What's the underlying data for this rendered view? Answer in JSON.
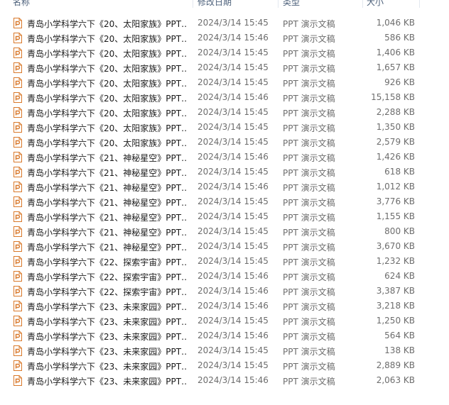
{
  "columns": {
    "name": "名称",
    "date": "修改日期",
    "type": "类型",
    "size": "大小"
  },
  "colors": {
    "icon": "#d9792b",
    "header_text": "#4c607a"
  },
  "files": [
    {
      "icon": "ppt-icon",
      "name": "青岛小学科学六下《20、太阳家族》PPT…",
      "date": "2024/3/14 15:45",
      "type": "PPT 演示文稿",
      "size": "1,046 KB"
    },
    {
      "icon": "ppt-icon",
      "name": "青岛小学科学六下《20、太阳家族》PPT…",
      "date": "2024/3/14 15:46",
      "type": "PPT 演示文稿",
      "size": "586 KB"
    },
    {
      "icon": "ppt-icon",
      "name": "青岛小学科学六下《20、太阳家族》PPT…",
      "date": "2024/3/14 15:45",
      "type": "PPT 演示文稿",
      "size": "1,406 KB"
    },
    {
      "icon": "ppt-icon",
      "name": "青岛小学科学六下《20、太阳家族》PPT…",
      "date": "2024/3/14 15:45",
      "type": "PPT 演示文稿",
      "size": "1,657 KB"
    },
    {
      "icon": "ppt-icon",
      "name": "青岛小学科学六下《20、太阳家族》PPT…",
      "date": "2024/3/14 15:45",
      "type": "PPT 演示文稿",
      "size": "926 KB"
    },
    {
      "icon": "ppt-icon",
      "name": "青岛小学科学六下《20、太阳家族》PPT…",
      "date": "2024/3/14 15:46",
      "type": "PPT 演示文稿",
      "size": "15,158 KB"
    },
    {
      "icon": "ppt-icon",
      "name": "青岛小学科学六下《20、太阳家族》PPT…",
      "date": "2024/3/14 15:45",
      "type": "PPT 演示文稿",
      "size": "2,288 KB"
    },
    {
      "icon": "ppt-icon",
      "name": "青岛小学科学六下《20、太阳家族》PPT…",
      "date": "2024/3/14 15:45",
      "type": "PPT 演示文稿",
      "size": "1,350 KB"
    },
    {
      "icon": "ppt-icon",
      "name": "青岛小学科学六下《20、太阳家族》PPT…",
      "date": "2024/3/14 15:45",
      "type": "PPT 演示文稿",
      "size": "2,579 KB"
    },
    {
      "icon": "ppt-icon",
      "name": "青岛小学科学六下《21、神秘星空》PPT…",
      "date": "2024/3/14 15:46",
      "type": "PPT 演示文稿",
      "size": "1,426 KB"
    },
    {
      "icon": "ppt-icon",
      "name": "青岛小学科学六下《21、神秘星空》PPT…",
      "date": "2024/3/14 15:45",
      "type": "PPT 演示文稿",
      "size": "618 KB"
    },
    {
      "icon": "ppt-icon",
      "name": "青岛小学科学六下《21、神秘星空》PPT…",
      "date": "2024/3/14 15:46",
      "type": "PPT 演示文稿",
      "size": "1,012 KB"
    },
    {
      "icon": "ppt-icon",
      "name": "青岛小学科学六下《21、神秘星空》PPT…",
      "date": "2024/3/14 15:45",
      "type": "PPT 演示文稿",
      "size": "3,776 KB"
    },
    {
      "icon": "ppt-icon",
      "name": "青岛小学科学六下《21、神秘星空》PPT…",
      "date": "2024/3/14 15:45",
      "type": "PPT 演示文稿",
      "size": "1,155 KB"
    },
    {
      "icon": "ppt-icon",
      "name": "青岛小学科学六下《21、神秘星空》PPT…",
      "date": "2024/3/14 15:45",
      "type": "PPT 演示文稿",
      "size": "800 KB"
    },
    {
      "icon": "ppt-icon",
      "name": "青岛小学科学六下《21、神秘星空》PPT…",
      "date": "2024/3/14 15:45",
      "type": "PPT 演示文稿",
      "size": "3,670 KB"
    },
    {
      "icon": "ppt-icon",
      "name": "青岛小学科学六下《22、探索宇宙》PPT…",
      "date": "2024/3/14 15:45",
      "type": "PPT 演示文稿",
      "size": "1,232 KB"
    },
    {
      "icon": "ppt-icon",
      "name": "青岛小学科学六下《22、探索宇宙》PPT…",
      "date": "2024/3/14 15:46",
      "type": "PPT 演示文稿",
      "size": "624 KB"
    },
    {
      "icon": "ppt-icon",
      "name": "青岛小学科学六下《22、探索宇宙》PPT…",
      "date": "2024/3/14 15:46",
      "type": "PPT 演示文稿",
      "size": "3,387 KB"
    },
    {
      "icon": "ppt-icon",
      "name": "青岛小学科学六下《23、未来家园》PPT…",
      "date": "2024/3/14 15:46",
      "type": "PPT 演示文稿",
      "size": "3,218 KB"
    },
    {
      "icon": "ppt-icon",
      "name": "青岛小学科学六下《23、未来家园》PPT…",
      "date": "2024/3/14 15:45",
      "type": "PPT 演示文稿",
      "size": "1,250 KB"
    },
    {
      "icon": "ppt-icon",
      "name": "青岛小学科学六下《23、未来家园》PPT…",
      "date": "2024/3/14 15:46",
      "type": "PPT 演示文稿",
      "size": "564 KB"
    },
    {
      "icon": "ppt-icon",
      "name": "青岛小学科学六下《23、未来家园》PPT…",
      "date": "2024/3/14 15:45",
      "type": "PPT 演示文稿",
      "size": "138 KB"
    },
    {
      "icon": "ppt-icon",
      "name": "青岛小学科学六下《23、未来家园》PPT…",
      "date": "2024/3/14 15:45",
      "type": "PPT 演示文稿",
      "size": "2,889 KB"
    },
    {
      "icon": "ppt-icon",
      "name": "青岛小学科学六下《23、未来家园》PPT…",
      "date": "2024/3/14 15:46",
      "type": "PPT 演示文稿",
      "size": "2,063 KB"
    }
  ]
}
